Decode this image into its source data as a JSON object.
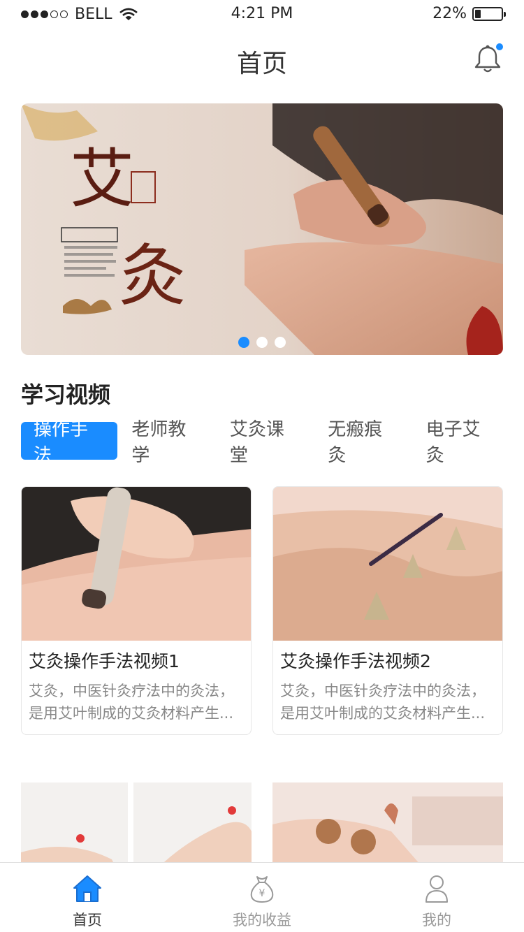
{
  "status_bar": {
    "carrier": "BELL",
    "time": "4:21 PM",
    "battery_text": "22%",
    "battery_level": 0.22,
    "signal_bars_filled": 3,
    "signal_bars_total": 5
  },
  "nav": {
    "title": "首页",
    "notification_icon": "bell-icon",
    "has_unread": true
  },
  "banner": {
    "slide_count": 3,
    "active_slide": 0
  },
  "section": {
    "title": "学习视频"
  },
  "tabs": [
    {
      "label": "操作手法",
      "active": true
    },
    {
      "label": "老师教学",
      "active": false
    },
    {
      "label": "艾灸课堂",
      "active": false
    },
    {
      "label": "无瘢痕灸",
      "active": false
    },
    {
      "label": "电子艾灸",
      "active": false
    }
  ],
  "videos": [
    {
      "title": "艾灸操作手法视频1",
      "desc": "艾灸，中医针灸疗法中的灸法，是用艾叶制成的艾灸材料产生..."
    },
    {
      "title": "艾灸操作手法视频2",
      "desc": "艾灸，中医针灸疗法中的灸法，是用艾叶制成的艾灸材料产生..."
    }
  ],
  "tab_bar": {
    "items": [
      {
        "label": "首页",
        "icon": "home-icon",
        "active": true
      },
      {
        "label": "我的收益",
        "icon": "money-bag-icon",
        "active": false
      },
      {
        "label": "我的",
        "icon": "user-icon",
        "active": false
      }
    ]
  },
  "colors": {
    "accent": "#1a8cff",
    "text_primary": "#222222",
    "text_secondary": "#888888",
    "inactive": "#999999"
  }
}
